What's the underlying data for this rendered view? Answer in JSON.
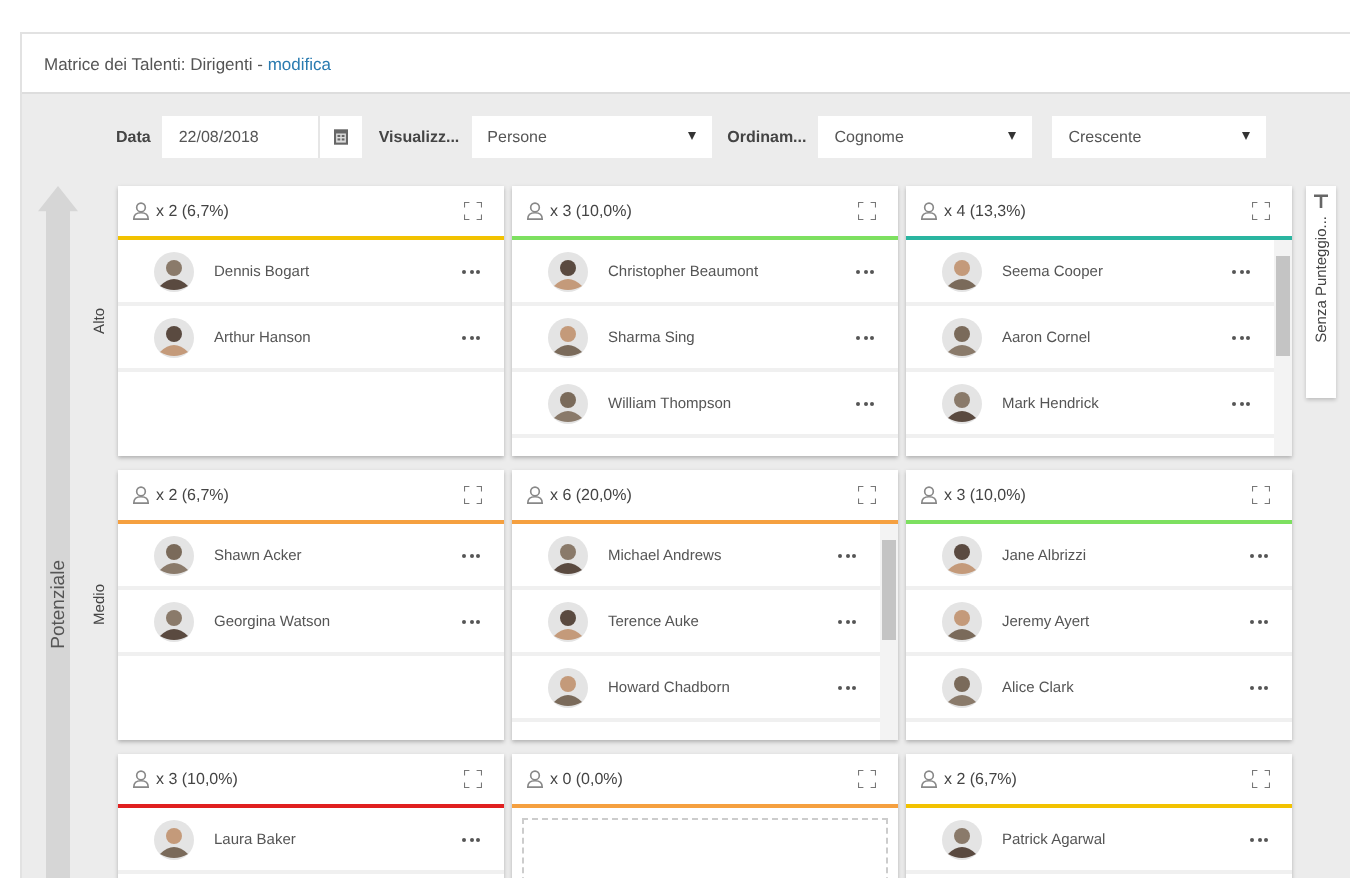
{
  "header": {
    "title": "Matrice dei Talenti: Dirigenti - ",
    "link": "modifica"
  },
  "filters": {
    "date_label": "Data",
    "date": "22/08/2018",
    "view_label": "Visualizz...",
    "view": "Persone",
    "sort_label": "Ordinam...",
    "sort": "Cognome",
    "order": "Crescente"
  },
  "axis": {
    "label": "Potenziale",
    "rows": [
      "Alto",
      "Medio"
    ]
  },
  "side_tab": {
    "label": "Senza Punteggio..."
  },
  "cells": [
    {
      "count": "x 2 (6,7%)",
      "color": "#f2c200",
      "scrollbar": false,
      "people": [
        "Dennis Bogart",
        "Arthur Hanson"
      ]
    },
    {
      "count": "x 3 (10,0%)",
      "color": "#7de060",
      "scrollbar": false,
      "people": [
        "Christopher Beaumont",
        "Sharma Sing",
        "William Thompson"
      ]
    },
    {
      "count": "x 4 (13,3%)",
      "color": "#2ab5a0",
      "scrollbar": true,
      "people": [
        "Seema Cooper",
        "Aaron Cornel",
        "Mark Hendrick"
      ]
    },
    {
      "count": "x 2 (6,7%)",
      "color": "#f5a040",
      "scrollbar": false,
      "people": [
        "Shawn Acker",
        "Georgina Watson"
      ]
    },
    {
      "count": "x 6 (20,0%)",
      "color": "#f5a040",
      "scrollbar": true,
      "people": [
        "Michael Andrews",
        "Terence Auke",
        "Howard Chadborn"
      ]
    },
    {
      "count": "x 3 (10,0%)",
      "color": "#7de060",
      "scrollbar": false,
      "people": [
        "Jane Albrizzi",
        "Jeremy Ayert",
        "Alice Clark"
      ]
    },
    {
      "count": "x 3 (10,0%)",
      "color": "#e02020",
      "scrollbar": false,
      "people": [
        "Laura Baker"
      ]
    },
    {
      "count": "x 0 (0,0%)",
      "color": "#f5a040",
      "scrollbar": false
    },
    {
      "count": "x 2 (6,7%)",
      "color": "#f2c200",
      "scrollbar": false,
      "people": [
        "Patrick Agarwal"
      ]
    }
  ]
}
